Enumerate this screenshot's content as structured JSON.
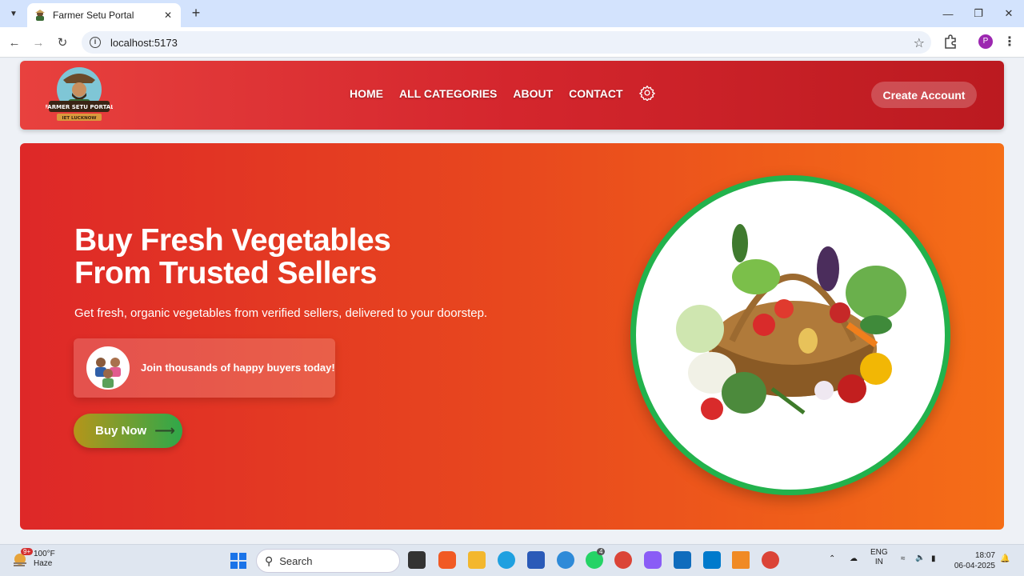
{
  "browser": {
    "tab_title": "Farmer Setu Portal",
    "new_tab": "+",
    "url": "localhost:5173",
    "profile_initial": "P"
  },
  "site": {
    "logo_text": "FARMER SETU PORTAL",
    "logo_subtext": "IET LUCKNOW",
    "nav": [
      "HOME",
      "ALL CATEGORIES",
      "ABOUT",
      "CONTACT"
    ],
    "create_account": "Create Account"
  },
  "hero": {
    "title_line1": "Buy Fresh Vegetables",
    "title_line2": "From Trusted Sellers",
    "subtitle": "Get fresh, organic vegetables from verified sellers, delivered to your doorstep.",
    "join_text": "Join thousands of happy buyers today!",
    "buy_now": "Buy Now",
    "ring_color": "#22b24c"
  },
  "taskbar": {
    "weather_badge": "9+",
    "temperature": "100°F",
    "condition": "Haze",
    "search_placeholder": "Search",
    "whatsapp_badge": "4",
    "lang_line1": "ENG",
    "lang_line2": "IN",
    "time": "18:07",
    "date": "06-04-2025"
  },
  "colors": {
    "header_start": "#e8413e",
    "header_end": "#bb1a20",
    "hero_start": "#de2828",
    "hero_end": "#f56e17"
  }
}
